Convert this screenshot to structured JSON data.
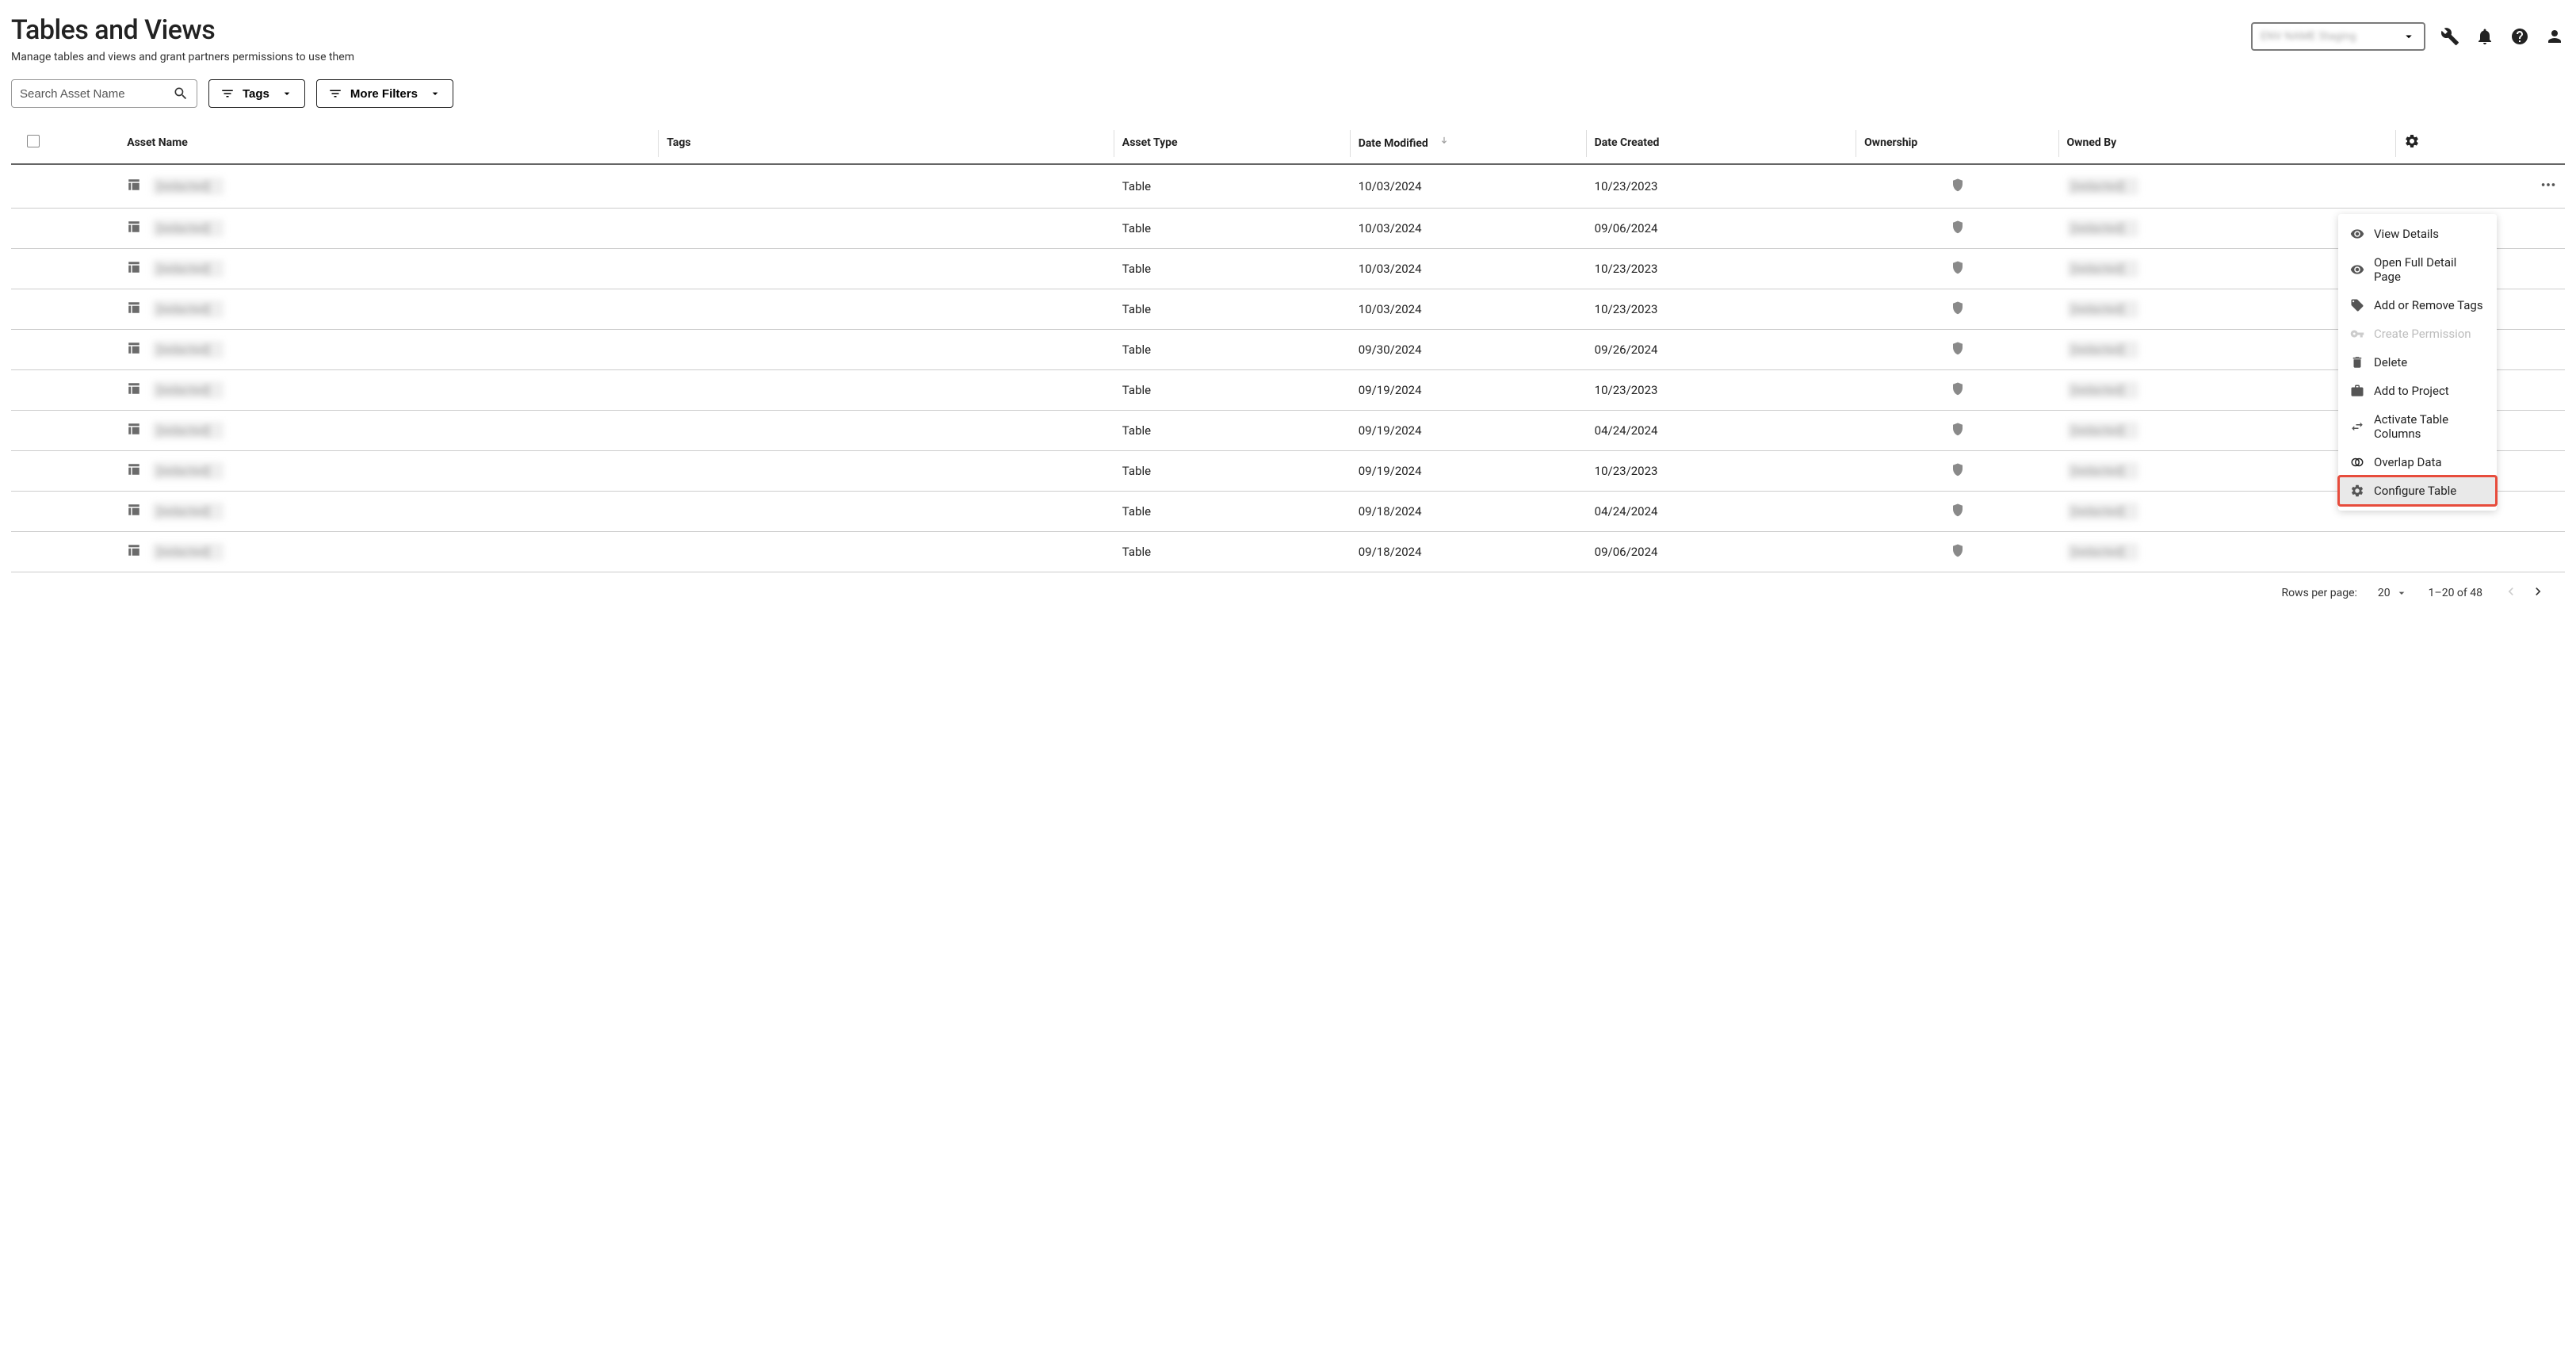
{
  "header": {
    "title": "Tables and Views",
    "subtitle": "Manage tables and views and grant partners permissions to use them",
    "env_selected": "ENV NAME Staging"
  },
  "controls": {
    "search_placeholder": "Search Asset Name",
    "tags_label": "Tags",
    "more_filters_label": "More Filters"
  },
  "columns": {
    "asset_name": "Asset Name",
    "tags": "Tags",
    "asset_type": "Asset Type",
    "date_modified": "Date Modified",
    "date_created": "Date Created",
    "ownership": "Ownership",
    "owned_by": "Owned By"
  },
  "rows": [
    {
      "name": "[redacted]",
      "type": "Table",
      "modified": "10/03/2024",
      "created": "10/23/2023",
      "owned_by": "[redacted]",
      "show_actions": true
    },
    {
      "name": "[redacted]",
      "type": "Table",
      "modified": "10/03/2024",
      "created": "09/06/2024",
      "owned_by": "[redacted]"
    },
    {
      "name": "[redacted]",
      "type": "Table",
      "modified": "10/03/2024",
      "created": "10/23/2023",
      "owned_by": "[redacted]"
    },
    {
      "name": "[redacted]",
      "type": "Table",
      "modified": "10/03/2024",
      "created": "10/23/2023",
      "owned_by": "[redacted]"
    },
    {
      "name": "[redacted]",
      "type": "Table",
      "modified": "09/30/2024",
      "created": "09/26/2024",
      "owned_by": "[redacted]"
    },
    {
      "name": "[redacted]",
      "type": "Table",
      "modified": "09/19/2024",
      "created": "10/23/2023",
      "owned_by": "[redacted]"
    },
    {
      "name": "[redacted]",
      "type": "Table",
      "modified": "09/19/2024",
      "created": "04/24/2024",
      "owned_by": "[redacted]"
    },
    {
      "name": "[redacted]",
      "type": "Table",
      "modified": "09/19/2024",
      "created": "10/23/2023",
      "owned_by": "[redacted]"
    },
    {
      "name": "[redacted]",
      "type": "Table",
      "modified": "09/18/2024",
      "created": "04/24/2024",
      "owned_by": "[redacted]"
    },
    {
      "name": "[redacted]",
      "type": "Table",
      "modified": "09/18/2024",
      "created": "09/06/2024",
      "owned_by": "[redacted]"
    }
  ],
  "context_menu": {
    "view_details": "View Details",
    "open_full": "Open Full Detail Page",
    "add_remove_tags": "Add or Remove Tags",
    "create_permission": "Create Permission",
    "delete": "Delete",
    "add_to_project": "Add to Project",
    "activate_columns": "Activate Table Columns",
    "overlap_data": "Overlap Data",
    "configure_table": "Configure Table"
  },
  "pagination": {
    "rows_label": "Rows per page:",
    "per_page": "20",
    "range": "1–20 of 48"
  }
}
